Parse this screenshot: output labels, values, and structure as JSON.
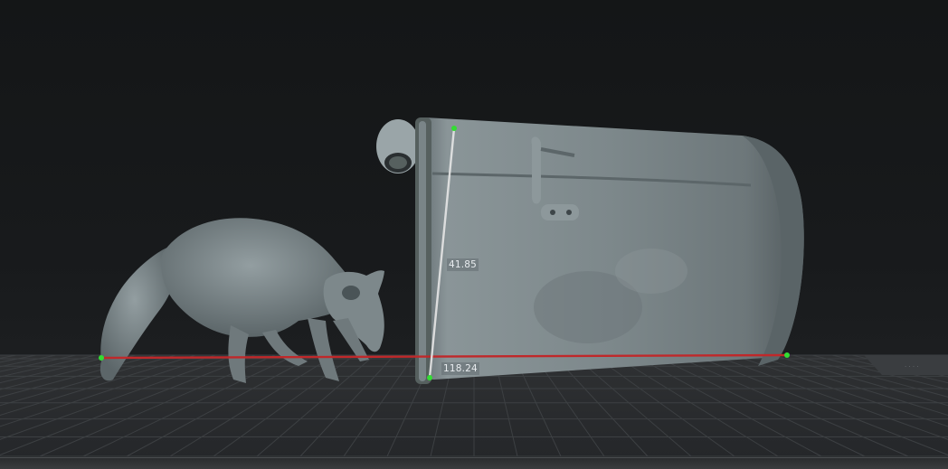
{
  "viewport": {
    "background_color": "#16181a",
    "ground_color": "#2b2d2f",
    "model_color": "#7f8b8f"
  },
  "measurements": {
    "vertical_length": "41.85",
    "horizontal_length": "118.24",
    "vertical_line_color": "#e6e6e6",
    "horizontal_line_color": "#c0282a",
    "point_color": "#33dd33"
  },
  "models": {
    "animal_icon": "raccoon-model",
    "object_icon": "trash-can-model"
  }
}
